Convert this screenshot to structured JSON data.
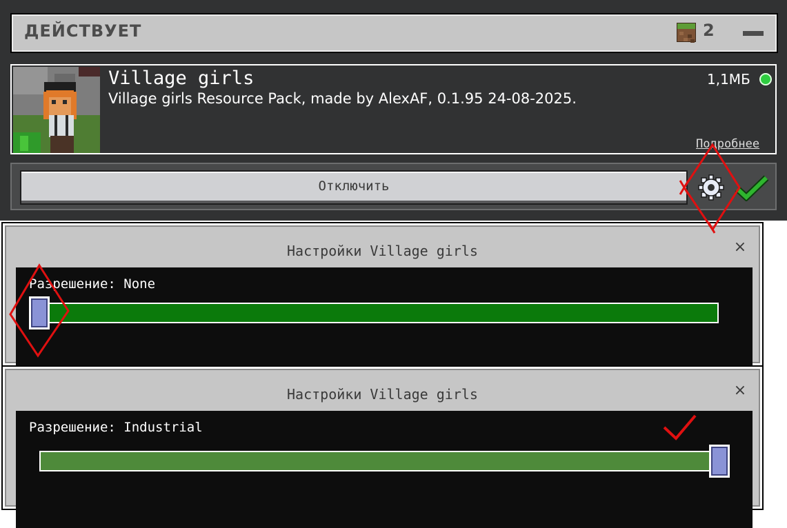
{
  "active_section": {
    "title": "ДЕЙСТВУЕТ",
    "pack_count": "2",
    "grass_icon": "grass-block-icon",
    "collapse_icon": "minus-icon"
  },
  "pack": {
    "name": "Village girls",
    "description": "Village girls Resource Pack, made by AlexAF, 0.1.95 24-08-2025.",
    "size": "1,1МБ",
    "status_color": "#2ecc40",
    "details_link": "Подробнее"
  },
  "actions": {
    "disable_label": "Отключить",
    "settings_icon": "gear-icon",
    "active_icon": "green-checkmark-icon"
  },
  "dialogs": [
    {
      "title": "Настройки Village girls",
      "close": "×",
      "slider_label": "Разрешение: None",
      "slider_level": 0,
      "track_color": "#0b7a0b"
    },
    {
      "title": "Настройки Village girls",
      "close": "×",
      "slider_label": "Разрешение: Industrial",
      "slider_level": 1,
      "track_color": "#4e8a3a"
    }
  ],
  "annotations": {
    "color": "#e01010",
    "marks": [
      "red-diamond-around-gear",
      "red-diamond-around-slider-thumb",
      "red-checkmark"
    ]
  }
}
